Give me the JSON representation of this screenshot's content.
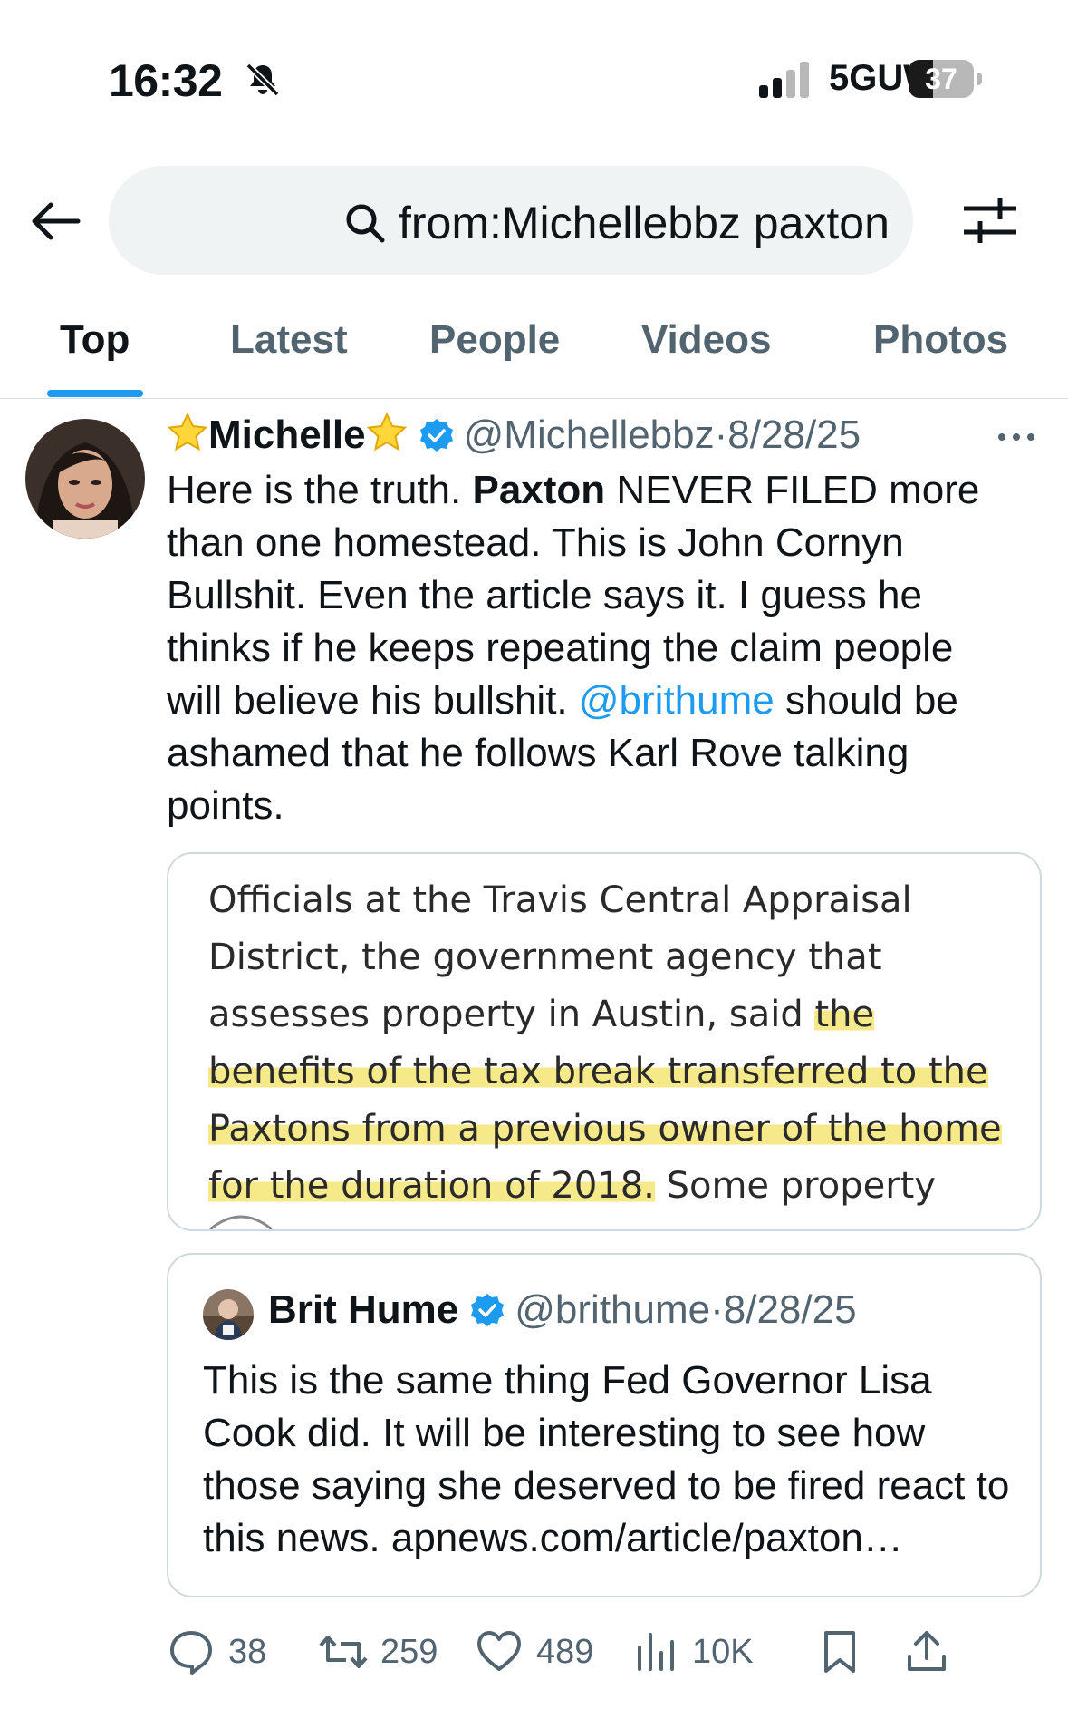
{
  "status_bar": {
    "time": "16:32",
    "network": "5GUW",
    "battery": "37",
    "battery_level": 0.37
  },
  "search": {
    "query": "from:Michellebbz paxton"
  },
  "tabs": [
    {
      "label": "Top",
      "active": true
    },
    {
      "label": "Latest",
      "active": false
    },
    {
      "label": "People",
      "active": false
    },
    {
      "label": "Videos",
      "active": false
    },
    {
      "label": "Photos",
      "active": false
    }
  ],
  "tweet": {
    "display_name": "Michelle",
    "handle": "@Michellebbz",
    "separator": "·",
    "date": "8/28/25",
    "text_1": "Here is the truth. ",
    "text_bold": "Paxton",
    "text_2": " NEVER FILED more than one homestead. This is John Cornyn Bullshit. Even the article says it. I guess he thinks if he keeps repeating the claim people will believe his bullshit. ",
    "mention": "@brithume",
    "text_3": " should be ashamed that he follows Karl Rove talking points.",
    "media": {
      "plain_1": "Officials at the Travis Central Appraisal District, the government agency that assesses property in Austin, said ",
      "highlight": "the benefits of the tax break transferred to the Paxtons from a previous owner of the home for the duration of 2018.",
      "plain_2": " Some property owners"
    },
    "quote": {
      "display_name": "Brit Hume",
      "handle": "@brithume",
      "separator": "·",
      "date": "8/28/25",
      "text": "This is the same thing Fed Governor Lisa Cook did. It will be interesting to see how those saying she deserved to be fired react to this news.  apnews.com/article/paxton…"
    },
    "stats": {
      "replies": "38",
      "reposts": "259",
      "likes": "489",
      "views": "10K"
    }
  },
  "colors": {
    "accent": "#1d9bf0",
    "text_primary": "#0f1419",
    "text_secondary": "#536471",
    "highlight": "#f6e98a"
  }
}
